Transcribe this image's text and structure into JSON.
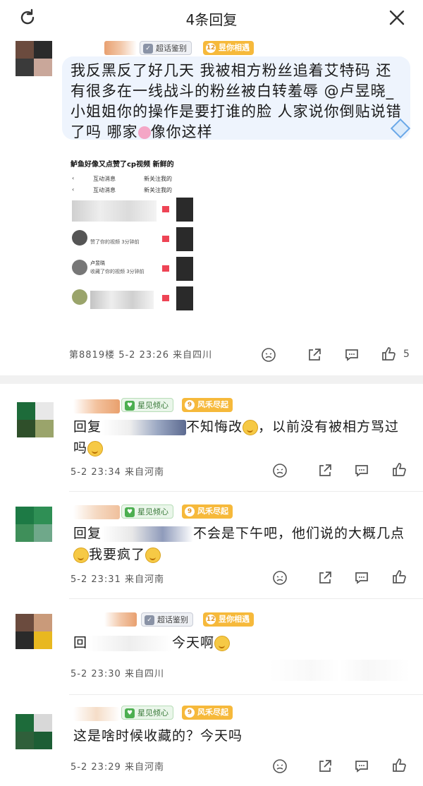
{
  "header": {
    "title": "4条回复",
    "refresh_icon": "refresh-icon",
    "close_icon": "close-icon"
  },
  "main_post": {
    "badges": [
      {
        "icon": "verify-icon",
        "text": "超话鉴别",
        "style": "gray"
      },
      {
        "icon": "level-12",
        "level": "12",
        "text": "昱你相遇",
        "style": "yellow"
      }
    ],
    "text": "我反黑反了好几天 我被相方粉丝追着艾特码 还有很多在一线战斗的粉丝被白转羞辱 @卢昱晓_小姐姐你的操作是要打谁的脸 人家说你倒贴说错了吗 哪家",
    "text_tail": "像你这样",
    "embed": {
      "caption": "鲈鱼好像又点赞了cp视频 新鲜的",
      "tab_left": "互动消息",
      "tab_right": "新关注我的",
      "rows": [
        {
          "sub": "赞了你的视频 3分钟前"
        },
        {
          "name": "卢昱晓",
          "sub": "收藏了你的视频 3分钟前"
        }
      ]
    },
    "meta": "第8819楼 5-2 23:26 来自四川",
    "like_count": "5"
  },
  "replies": [
    {
      "badges": [
        {
          "text": "星见倾心",
          "style": "green"
        },
        {
          "level": "9",
          "text": "风禾尽起",
          "style": "yellow"
        }
      ],
      "prefix": "回复",
      "text": "不知悔改",
      "text2": "，以前没有被相方骂过吗",
      "meta": "5-2 23:34 来自河南"
    },
    {
      "badges": [
        {
          "text": "星见倾心",
          "style": "green"
        },
        {
          "level": "9",
          "text": "风禾尽起",
          "style": "yellow"
        }
      ],
      "prefix": "回复",
      "text": "不会是下午吧，他们说的大概几点",
      "text2": "我要疯了",
      "meta": "5-2 23:31 来自河南"
    },
    {
      "badges": [
        {
          "text": "超话鉴别",
          "style": "gray"
        },
        {
          "level": "12",
          "text": "昱你相遇",
          "style": "yellow"
        }
      ],
      "prefix": "回",
      "text": "今天啊",
      "meta": "5-2 23:30 来自四川"
    },
    {
      "badges": [
        {
          "text": "星见倾心",
          "style": "green"
        },
        {
          "level": "9",
          "text": "风禾尽起",
          "style": "yellow"
        }
      ],
      "text": "这是啥时候收藏的？今天吗",
      "meta": "5-2 23:29 来自河南"
    }
  ],
  "colors": {
    "bubble": "#eef4fd",
    "level_badge": "#f6b93b",
    "gap": "#f1f1f1"
  }
}
